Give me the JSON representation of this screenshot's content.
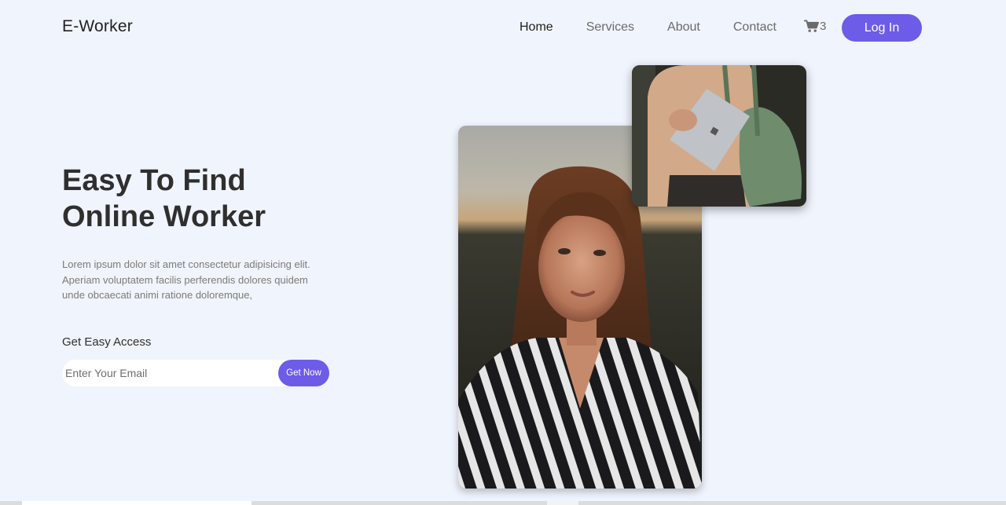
{
  "nav": {
    "brand": "E-Worker",
    "links": [
      {
        "label": "Home",
        "active": true
      },
      {
        "label": "Services",
        "active": false
      },
      {
        "label": "About",
        "active": false
      },
      {
        "label": "Contact",
        "active": false
      }
    ],
    "cart": {
      "icon": "cart-icon",
      "count": "3"
    },
    "login_label": "Log In"
  },
  "hero": {
    "title_line1": "Easy To Find",
    "title_line2": "Online Worker",
    "description_line1": "Lorem ipsum dolor sit amet consectetur adipisicing elit.",
    "description_line2": "Aperiam voluptatem facilis perferendis dolores quidem",
    "description_line3": "unde obcaecati animi ratione doloremque,",
    "access_label": "Get Easy Access",
    "email_placeholder": "Enter Your Email",
    "email_value": "",
    "submit_label": "Get Now"
  },
  "colors": {
    "background": "#f0f4fd",
    "accent": "#6c5ce7",
    "text_dark": "#2f2f2f",
    "text_muted": "#7a7a7a"
  }
}
